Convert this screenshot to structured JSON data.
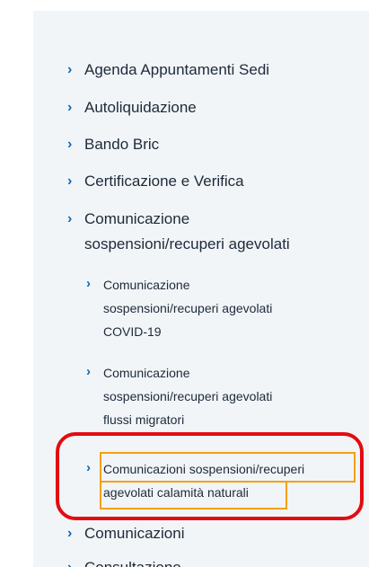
{
  "nav": {
    "items": [
      {
        "label": "Agenda Appuntamenti Sedi"
      },
      {
        "label": "Autoliquidazione"
      },
      {
        "label": "Bando Bric"
      },
      {
        "label": "Certificazione e Verifica"
      },
      {
        "label_line1": "Comunicazione",
        "label_line2": "sospensioni/recuperi agevolati"
      },
      {
        "label": "Comunicazioni"
      },
      {
        "label": "Consultazione"
      }
    ],
    "subitems": [
      {
        "line1": "Comunicazione",
        "line2": "sospensioni/recuperi agevolati",
        "line3": "COVID-19"
      },
      {
        "line1": "Comunicazione",
        "line2": "sospensioni/recuperi agevolati",
        "line3": "flussi migratori"
      },
      {
        "line1": "Comunicazioni sospensioni/recuperi",
        "line2": "agevolati calamità naturali"
      }
    ],
    "chevron": "›"
  },
  "colors": {
    "chevron": "#0d6bb7",
    "focus_outline": "#f4a012",
    "annotation_ring": "#e30b12",
    "panel_bg": "#f2f5f7"
  }
}
